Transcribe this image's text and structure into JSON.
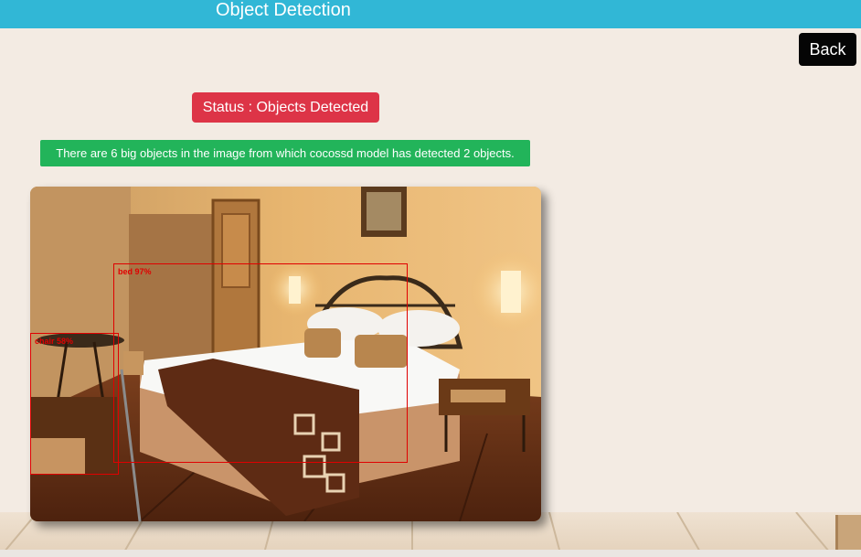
{
  "header": {
    "title": "Object Detection"
  },
  "back_label": "Back",
  "status": {
    "label": "Status : Objects Detected",
    "color": "#dd3447"
  },
  "info": {
    "message": "There are 6 big objects in the image from which cocossd model has detected 2 objects.",
    "color": "#22b45a"
  },
  "image": {
    "description_icon": "hotel-bedroom-photo",
    "detections": [
      {
        "label": "bed 97%"
      },
      {
        "label": "chair 58%"
      }
    ]
  },
  "colors": {
    "header": "#31b7d6",
    "background": "#f3ebe3",
    "detection_box": "#e00000"
  }
}
